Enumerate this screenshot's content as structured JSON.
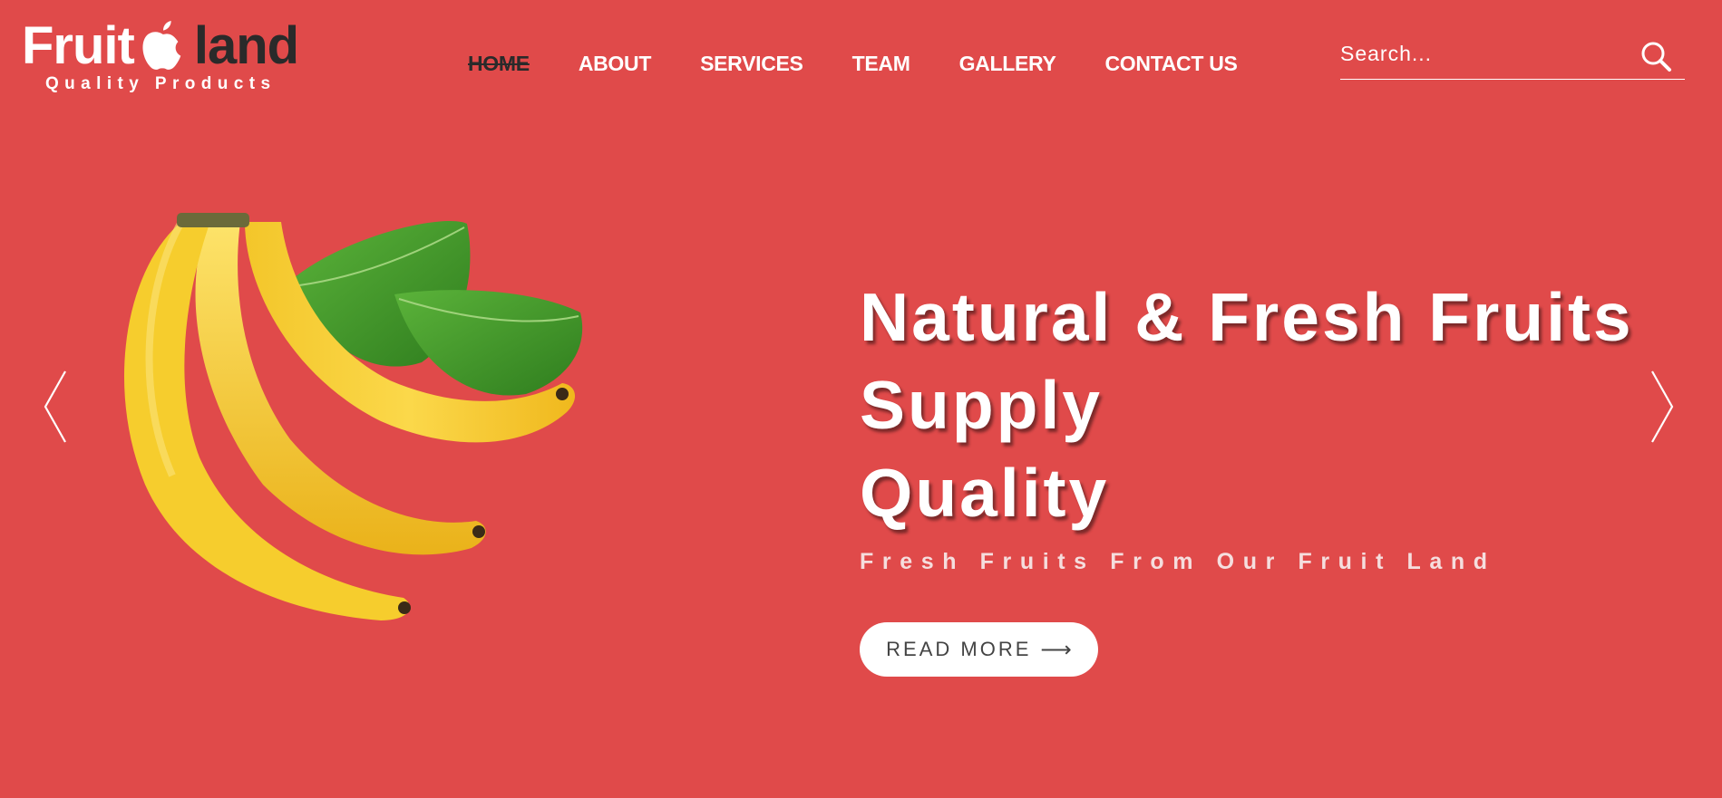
{
  "header": {
    "logo": {
      "word1": "Fruit",
      "word2": "land",
      "tagline": "Quality Products",
      "icon": "apple-icon"
    },
    "nav": [
      {
        "label": "HOME",
        "active": true
      },
      {
        "label": "ABOUT",
        "active": false
      },
      {
        "label": "SERVICES",
        "active": false
      },
      {
        "label": "TEAM",
        "active": false
      },
      {
        "label": "GALLERY",
        "active": false
      },
      {
        "label": "CONTACT US",
        "active": false
      }
    ],
    "search": {
      "placeholder": "Search...",
      "value": "",
      "icon": "search-icon"
    }
  },
  "hero": {
    "title_lines": [
      "Natural & Fresh Fruits",
      "Supply",
      "Quality"
    ],
    "subtitle": "Fresh Fruits From Our Fruit Land",
    "button_label": "READ MORE",
    "button_icon": "right-arrow-icon",
    "prev_icon": "chevron-left-icon",
    "next_icon": "chevron-right-icon",
    "image": "bananas-image"
  },
  "colors": {
    "background": "#e04a4a",
    "text": "#ffffff",
    "dark": "#2a2a2a",
    "button_bg": "#ffffff",
    "button_text": "#444444"
  }
}
